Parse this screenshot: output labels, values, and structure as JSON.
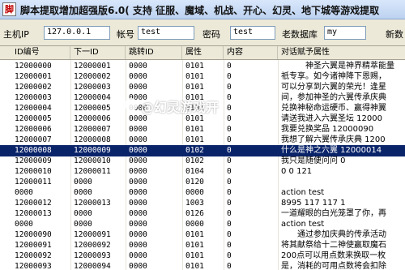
{
  "window": {
    "title": "脚本提取增加超强版6.0( 支持 征服、魔域、机战、开心、幻灵、地下城等游戏提取",
    "icon_name": "app-logo-icon"
  },
  "form": {
    "host_label": "主机IP",
    "host_value": "127.0.0.1",
    "account_label": "帐号",
    "account_value": "test",
    "password_label": "密码",
    "password_value": "test",
    "olddb_label": "老数据库",
    "olddb_value": "my",
    "newdb_label": "新数"
  },
  "grid": {
    "headers": [
      "ID编号",
      "下一ID",
      "跳转ID",
      "属性",
      "内容",
      "对话赋予属性"
    ],
    "rows": [
      [
        "12000000",
        "12000001",
        "0000",
        "0101",
        "0",
        "　　　神圣六翼是神界精萃能量"
      ],
      [
        "12000001",
        "12000002",
        "0000",
        "0101",
        "0",
        "祇专享。如今诸神降下恩赐，"
      ],
      [
        "12000002",
        "12000003",
        "0000",
        "0101",
        "0",
        "可以分享到六翼的荣光！逢星"
      ],
      [
        "12000003",
        "12000004",
        "0000",
        "0101",
        "0",
        "间，参加神圣的六翼传承庆典"
      ],
      [
        "12000004",
        "12000005",
        "0000",
        "0101",
        "0",
        "兑换神秘命运硬币、赢得神翼"
      ],
      [
        "12000005",
        "12000006",
        "0000",
        "0101",
        "0",
        "请送我进入六翼圣坛 12000"
      ],
      [
        "12000006",
        "12000007",
        "0000",
        "0101",
        "0",
        "我要兑换奖品 12000090"
      ],
      [
        "12000007",
        "12000008",
        "0000",
        "0101",
        "0",
        "我想了解六翼传承庆典 1200"
      ],
      [
        "12000008",
        "12000009",
        "0000",
        "0102",
        "0",
        "什么是神之六翼 12000014"
      ],
      [
        "12000009",
        "12000010",
        "0000",
        "0102",
        "0",
        "我只是随便问问 0"
      ],
      [
        "12000010",
        "12000011",
        "0000",
        "0104",
        "0",
        "0 0 121"
      ],
      [
        "12000011",
        "0000",
        "0000",
        "0120",
        "0",
        ""
      ],
      [
        "0000",
        "0000",
        "0000",
        "0000",
        "0",
        "action test"
      ],
      [
        "12000012",
        "12000013",
        "0000",
        "1003",
        "0",
        "8995 117 117 1"
      ],
      [
        "12000013",
        "0000",
        "0000",
        "0126",
        "0",
        "一道耀眼的白光笼罩了你，再"
      ],
      [
        "0000",
        "0000",
        "0000",
        "0000",
        "0",
        "action test"
      ],
      [
        "12000090",
        "12000091",
        "0000",
        "0101",
        "0",
        "　　通过参加庆典的传承活动"
      ],
      [
        "12000091",
        "12000092",
        "0000",
        "0101",
        "0",
        "将其献祭给十二神使赢取魔石"
      ],
      [
        "12000092",
        "12000093",
        "0000",
        "0101",
        "0",
        "200点可以用点数来换取一枚"
      ],
      [
        "12000093",
        "12000094",
        "0000",
        "0101",
        "0",
        "是，消耗的可用点数将会扣除"
      ]
    ],
    "selected_row": 8
  },
  "watermark": {
    "text": "@幻灵游戏开",
    "icon_name": "watermark-logo-icon"
  },
  "colors": {
    "selection": "#0a246a",
    "titlebar": "#bcd2f0",
    "form_bg": "#ece9d8"
  }
}
